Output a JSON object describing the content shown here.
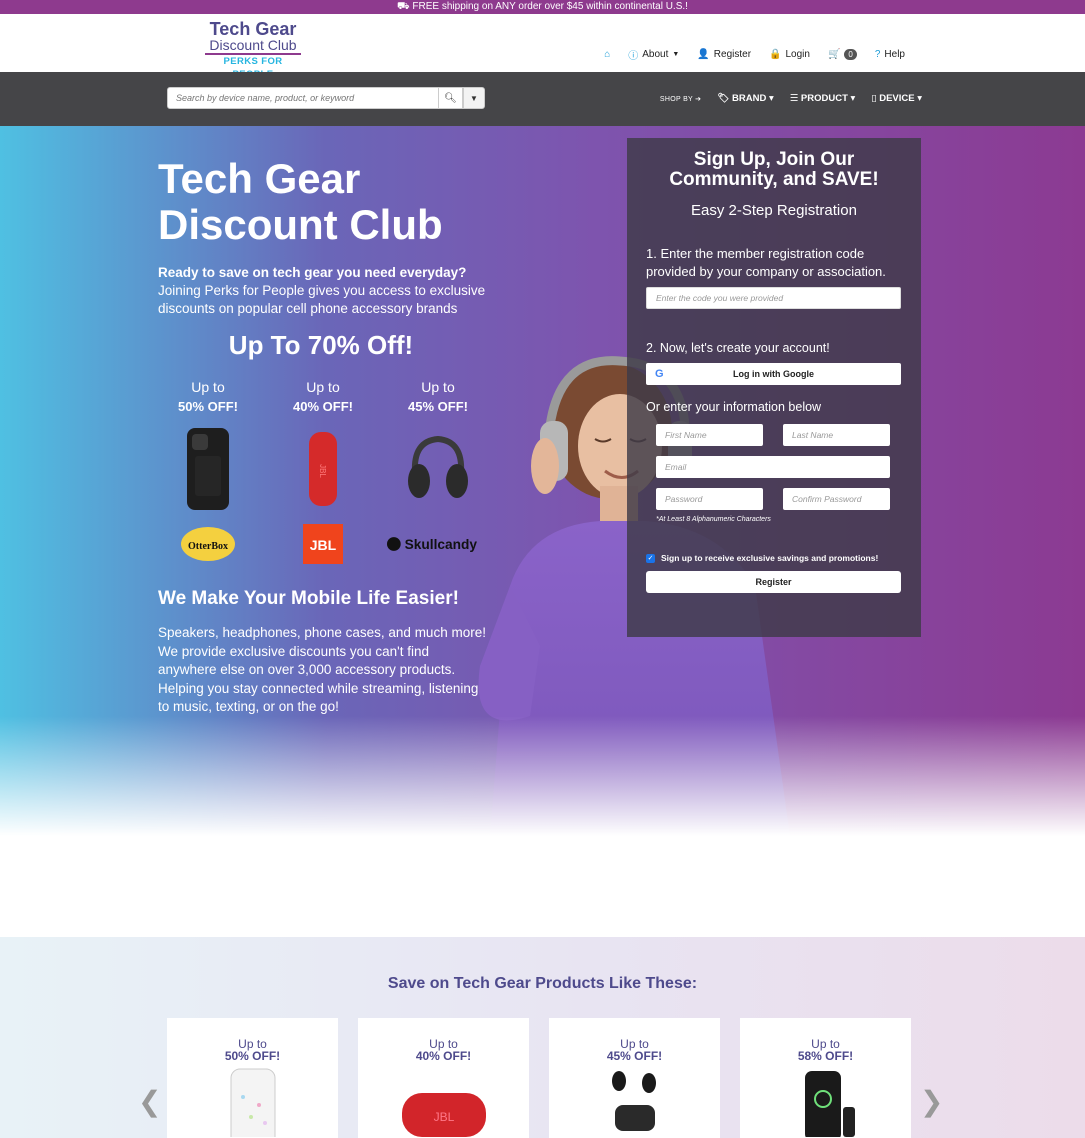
{
  "promo": {
    "text": "⛟ FREE shipping on ANY order over $45 within continental U.S.!"
  },
  "logo": {
    "line1": "Tech Gear",
    "line2": "Discount Club",
    "line3": "PERKS FOR PEOPLE"
  },
  "topnav": {
    "home_icon": "home-icon",
    "about": "About",
    "register": "Register",
    "login": "Login",
    "cart_count": "0",
    "help": "Help"
  },
  "search": {
    "placeholder": "Search by device name, product, or keyword"
  },
  "shopnav": {
    "shop_by": "SHOP BY",
    "brand": "BRAND",
    "product": "PRODUCT",
    "device": "DEVICE"
  },
  "hero": {
    "title_line1": "Tech Gear",
    "title_line2": "Discount Club",
    "intro_bold": "Ready to save on tech gear you need everyday?",
    "intro_rest": "Joining Perks for People gives you access to exclusive discounts on popular cell phone accessory brands",
    "headline": "Up To 70% Off!",
    "deals": [
      {
        "upto": "Up to",
        "percent": "50% OFF!",
        "brand": "OtterBox"
      },
      {
        "upto": "Up to",
        "percent": "40% OFF!",
        "brand": "JBL"
      },
      {
        "upto": "Up to",
        "percent": "45% OFF!",
        "brand": "Skullcandy"
      }
    ],
    "easier_title": "We Make Your Mobile Life Easier!",
    "easier_text": "Speakers, headphones, phone cases, and much more! We provide exclusive discounts you can't find anywhere else on over 3,000 accessory products. Helping you stay connected while streaming, listening to music, texting, or on the go!"
  },
  "signup": {
    "title": "Sign Up, Join Our Community, and SAVE!",
    "subtitle": "Easy 2-Step Registration",
    "step1": "1. Enter the member registration code provided by your company or association.",
    "code_placeholder": "Enter the code you were provided",
    "step2": "2. Now, let's create your account!",
    "google_btn": "Log in with Google",
    "or_text": "Or enter your information below",
    "first_name": "First Name",
    "last_name": "Last Name",
    "email": "Email",
    "password": "Password",
    "confirm_password": "Confirm Password",
    "pw_note": "*At Least 8 Alphanumeric Characters",
    "optin": "Sign up to receive exclusive savings and promotions!",
    "register_btn": "Register"
  },
  "products": {
    "title": "Save on Tech Gear Products Like These:",
    "cards": [
      {
        "upto": "Up to",
        "percent": "50% OFF!"
      },
      {
        "upto": "Up to",
        "percent": "40% OFF!"
      },
      {
        "upto": "Up to",
        "percent": "45% OFF!"
      },
      {
        "upto": "Up to",
        "percent": "58% OFF!"
      }
    ]
  },
  "colors": {
    "brand_purple": "#4e4a8c",
    "accent_magenta": "#8e3a8e",
    "accent_blue": "#26b5e0"
  }
}
